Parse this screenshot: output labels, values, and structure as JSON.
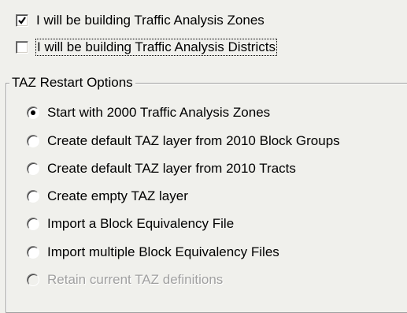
{
  "options": {
    "build_zones": {
      "label": "I will be building Traffic Analysis Zones",
      "checked": true
    },
    "build_districts": {
      "label": "I will be building Traffic Analysis Districts",
      "checked": false
    }
  },
  "restart_group": {
    "title": "TAZ Restart Options",
    "selected": "Start with 2000 Traffic Analysis Zones",
    "items": [
      {
        "label": "Start with 2000 Traffic Analysis Zones",
        "selected": true,
        "enabled": true
      },
      {
        "label": "Create default TAZ layer from 2010 Block Groups",
        "selected": false,
        "enabled": true
      },
      {
        "label": "Create default TAZ layer from 2010 Tracts",
        "selected": false,
        "enabled": true
      },
      {
        "label": "Create empty TAZ layer",
        "selected": false,
        "enabled": true
      },
      {
        "label": "Import a Block Equivalency File",
        "selected": false,
        "enabled": true
      },
      {
        "label": "Import multiple Block Equivalency Files",
        "selected": false,
        "enabled": true
      },
      {
        "label": "Retain current TAZ definitions",
        "selected": false,
        "enabled": false
      }
    ]
  }
}
